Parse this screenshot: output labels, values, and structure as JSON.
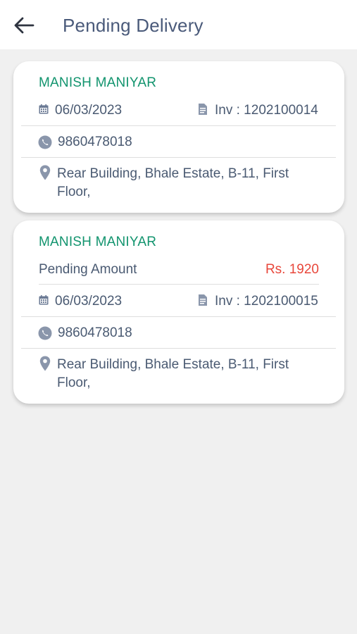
{
  "header": {
    "title": "Pending Delivery",
    "back_icon": "arrow-left-icon"
  },
  "colors": {
    "customer_name": "#12946e",
    "amount": "#e8473b",
    "text": "#4a5a72",
    "background": "#f0f0f0"
  },
  "deliveries": [
    {
      "customer_name": "MANISH MANIYAR",
      "date": "06/03/2023",
      "invoice": "Inv : 1202100014",
      "phone": "9860478018",
      "address": "Rear Building, Bhale Estate, B-11, First Floor,"
    },
    {
      "customer_name": "MANISH MANIYAR",
      "pending_label": "Pending Amount",
      "pending_amount": "Rs. 1920",
      "date": "06/03/2023",
      "invoice": "Inv : 1202100015",
      "phone": "9860478018",
      "address": "Rear Building, Bhale Estate, B-11, First Floor,"
    }
  ]
}
